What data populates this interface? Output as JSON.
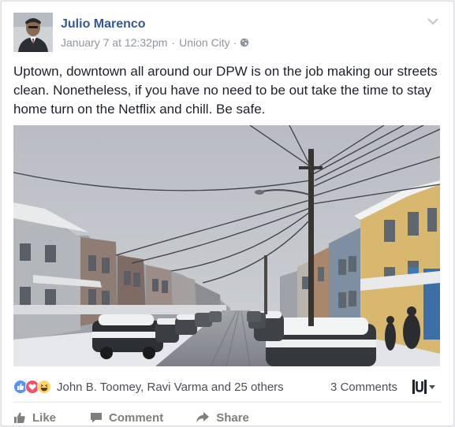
{
  "post": {
    "author": "Julio Marenco",
    "date": "January 7 at 12:32pm",
    "location": "Union City",
    "privacy_icon": "globe-icon",
    "text": "Uptown, downtown all around our DPW is on the job making our streets clean. Nonetheless, if you have no need to be out take the time to stay home turn on the Netflix and chill. Be safe."
  },
  "reactions": {
    "icons": [
      "like-reaction-icon",
      "love-reaction-icon",
      "haha-reaction-icon"
    ],
    "names": "John B. Toomey, Ravi Varma and 25 others",
    "comments": "3 Comments"
  },
  "actions": {
    "like": "Like",
    "comment": "Comment",
    "share": "Share"
  },
  "colors": {
    "link": "#365899",
    "meta": "#90949c",
    "like_blue": "#5890ff",
    "love_red": "#f25268",
    "haha_yellow": "#fcd669"
  }
}
